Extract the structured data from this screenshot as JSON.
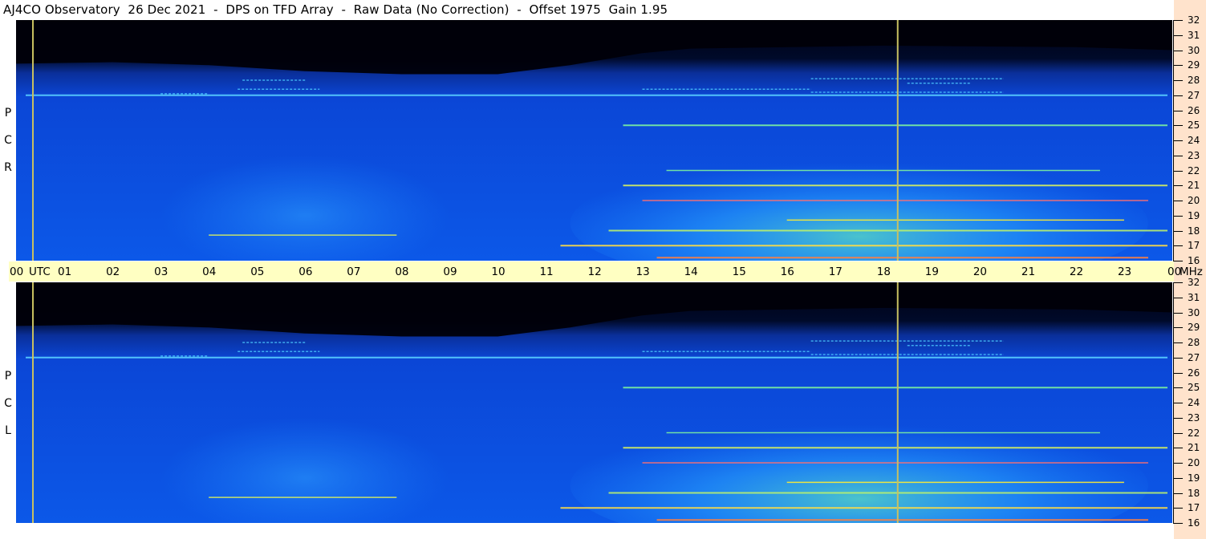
{
  "title": "AJ4CO Observatory  26 Dec 2021  -  DPS on TFD Array  -  Raw Data (No Correction)  -  Offset 1975  Gain 1.95",
  "chart_data": [
    {
      "type": "heatmap",
      "panel": "RCP",
      "polarization_label": [
        "R",
        "C",
        "P"
      ],
      "xlabel": "UTC",
      "ylabel": "MHz",
      "x_ticks": [
        "00",
        "01",
        "02",
        "03",
        "04",
        "05",
        "06",
        "07",
        "08",
        "09",
        "10",
        "11",
        "12",
        "13",
        "14",
        "15",
        "16",
        "17",
        "18",
        "19",
        "20",
        "21",
        "22",
        "23",
        "00"
      ],
      "y_ticks": [
        32,
        31,
        30,
        29,
        28,
        27,
        26,
        25,
        24,
        23,
        22,
        21,
        20,
        19,
        18,
        17,
        16
      ],
      "xlim": [
        0,
        24
      ],
      "ylim": [
        16,
        32
      ],
      "colors": {
        "background": "#0a47d8",
        "low": "#000016",
        "mid": "#1e88ff",
        "high": "#7cf0a0",
        "peak": "#ffee33",
        "rfi": "#ff6060",
        "marker": "#c8c060"
      },
      "marker_lines_utc": [
        0.35,
        18.3
      ]
    },
    {
      "type": "heatmap",
      "panel": "LCP",
      "polarization_label": [
        "L",
        "C",
        "P"
      ],
      "xlabel": "UTC",
      "ylabel": "MHz",
      "x_ticks": [
        "00",
        "01",
        "02",
        "03",
        "04",
        "05",
        "06",
        "07",
        "08",
        "09",
        "10",
        "11",
        "12",
        "13",
        "14",
        "15",
        "16",
        "17",
        "18",
        "19",
        "20",
        "21",
        "22",
        "23",
        "00"
      ],
      "y_ticks": [
        32,
        31,
        30,
        29,
        28,
        27,
        26,
        25,
        24,
        23,
        22,
        21,
        20,
        19,
        18,
        17,
        16
      ],
      "xlim": [
        0,
        24
      ],
      "ylim": [
        16,
        32
      ],
      "colors": {
        "background": "#0a47d8",
        "low": "#000016",
        "mid": "#1e88ff",
        "high": "#7cf0a0",
        "peak": "#ffee33",
        "rfi": "#ff6060",
        "marker": "#c8c060"
      },
      "marker_lines_utc": [
        0.35,
        18.3
      ]
    }
  ],
  "rfi_bands_mhz": [
    27.0,
    25.0,
    22.0,
    21.0,
    20.0,
    18.7,
    18.0,
    17.0,
    16.2
  ]
}
